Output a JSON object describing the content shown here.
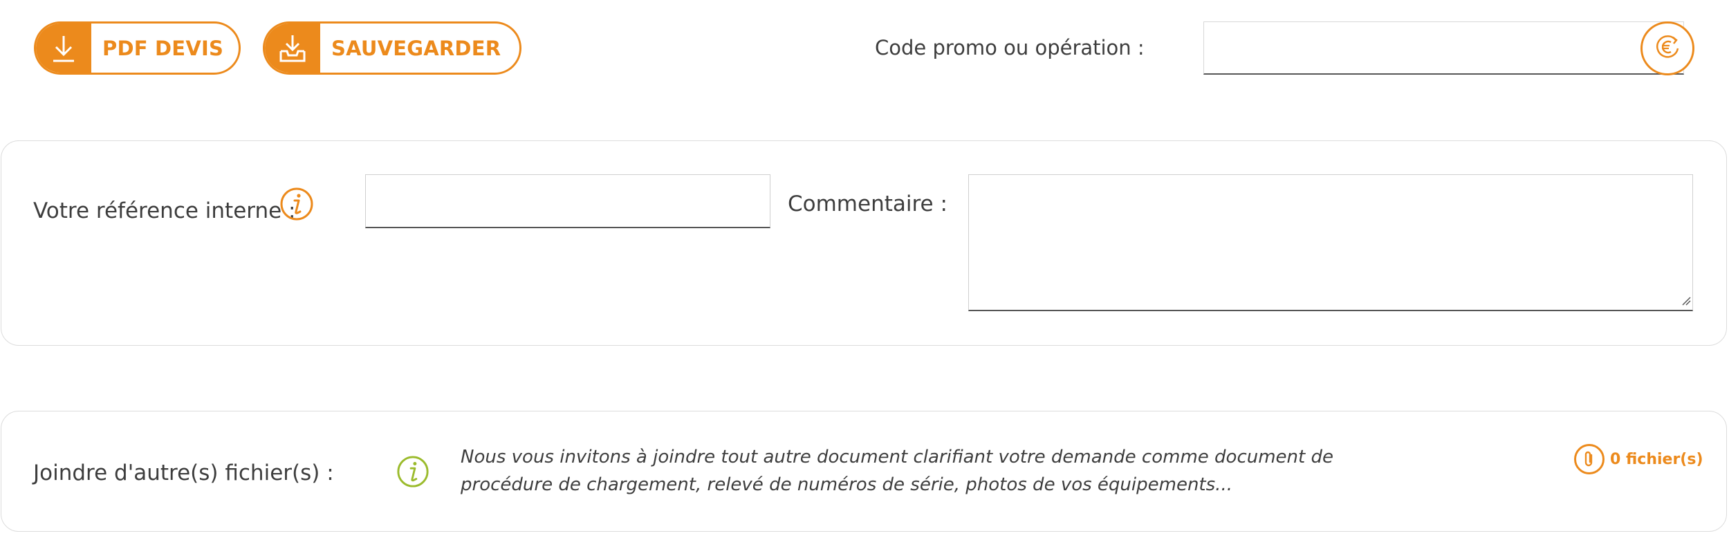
{
  "toolbar": {
    "pdf_label": "PDF DEVIS",
    "save_label": "SAUVEGARDER"
  },
  "promo": {
    "label": "Code promo ou opération :",
    "value": "",
    "apply_icon": "euro-refresh-icon"
  },
  "reference": {
    "label": "Votre référence interne :",
    "info_icon": "info-icon",
    "value": ""
  },
  "comment": {
    "label": "Commentaire :",
    "value": ""
  },
  "files": {
    "label": "Joindre d'autre(s) fichier(s) :",
    "info_icon": "info-icon",
    "note": "Nous vous invitons à joindre tout autre document clarifiant votre demande comme document de procédure de chargement, relevé de numéros de série, photos de vos équipements...",
    "count_label": "0 fichier(s)",
    "attach_icon": "paperclip-icon"
  },
  "colors": {
    "accent": "#ec8a1c",
    "info_green": "#9bbb2c",
    "text": "#3d3d3d"
  }
}
